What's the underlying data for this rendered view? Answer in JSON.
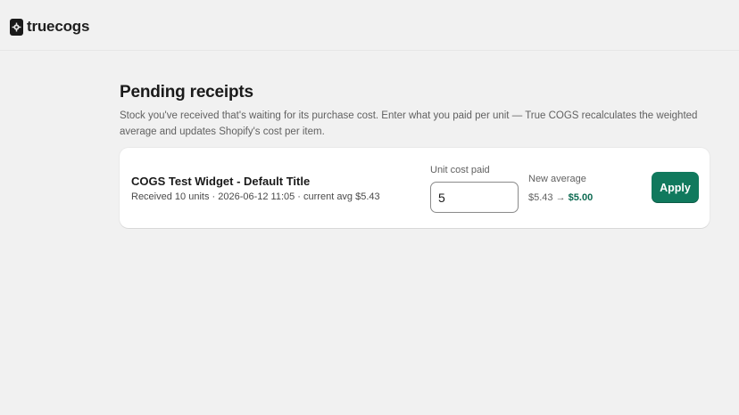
{
  "app": {
    "name": "truecogs",
    "logo_icon": "gear-logo-icon"
  },
  "page": {
    "title": "Pending receipts",
    "description": "Stock you've received that's waiting for its purchase cost. Enter what you paid per unit — True COGS recalculates the weighted average and updates Shopify's cost per item."
  },
  "receipts": [
    {
      "product": "COGS Test Widget - Default Title",
      "meta": "Received 10 units · 2026-06-12 11:05 · current avg $5.43",
      "unit_cost_label": "Unit cost paid",
      "unit_cost_value": "5",
      "new_average_label": "New average",
      "old_average": "$5.43",
      "arrow": "→",
      "new_average": "$5.00",
      "apply_label": "Apply"
    }
  ],
  "colors": {
    "background": "#f1f1f1",
    "accent": "#10795d",
    "new_average_text": "#0d6b52"
  }
}
